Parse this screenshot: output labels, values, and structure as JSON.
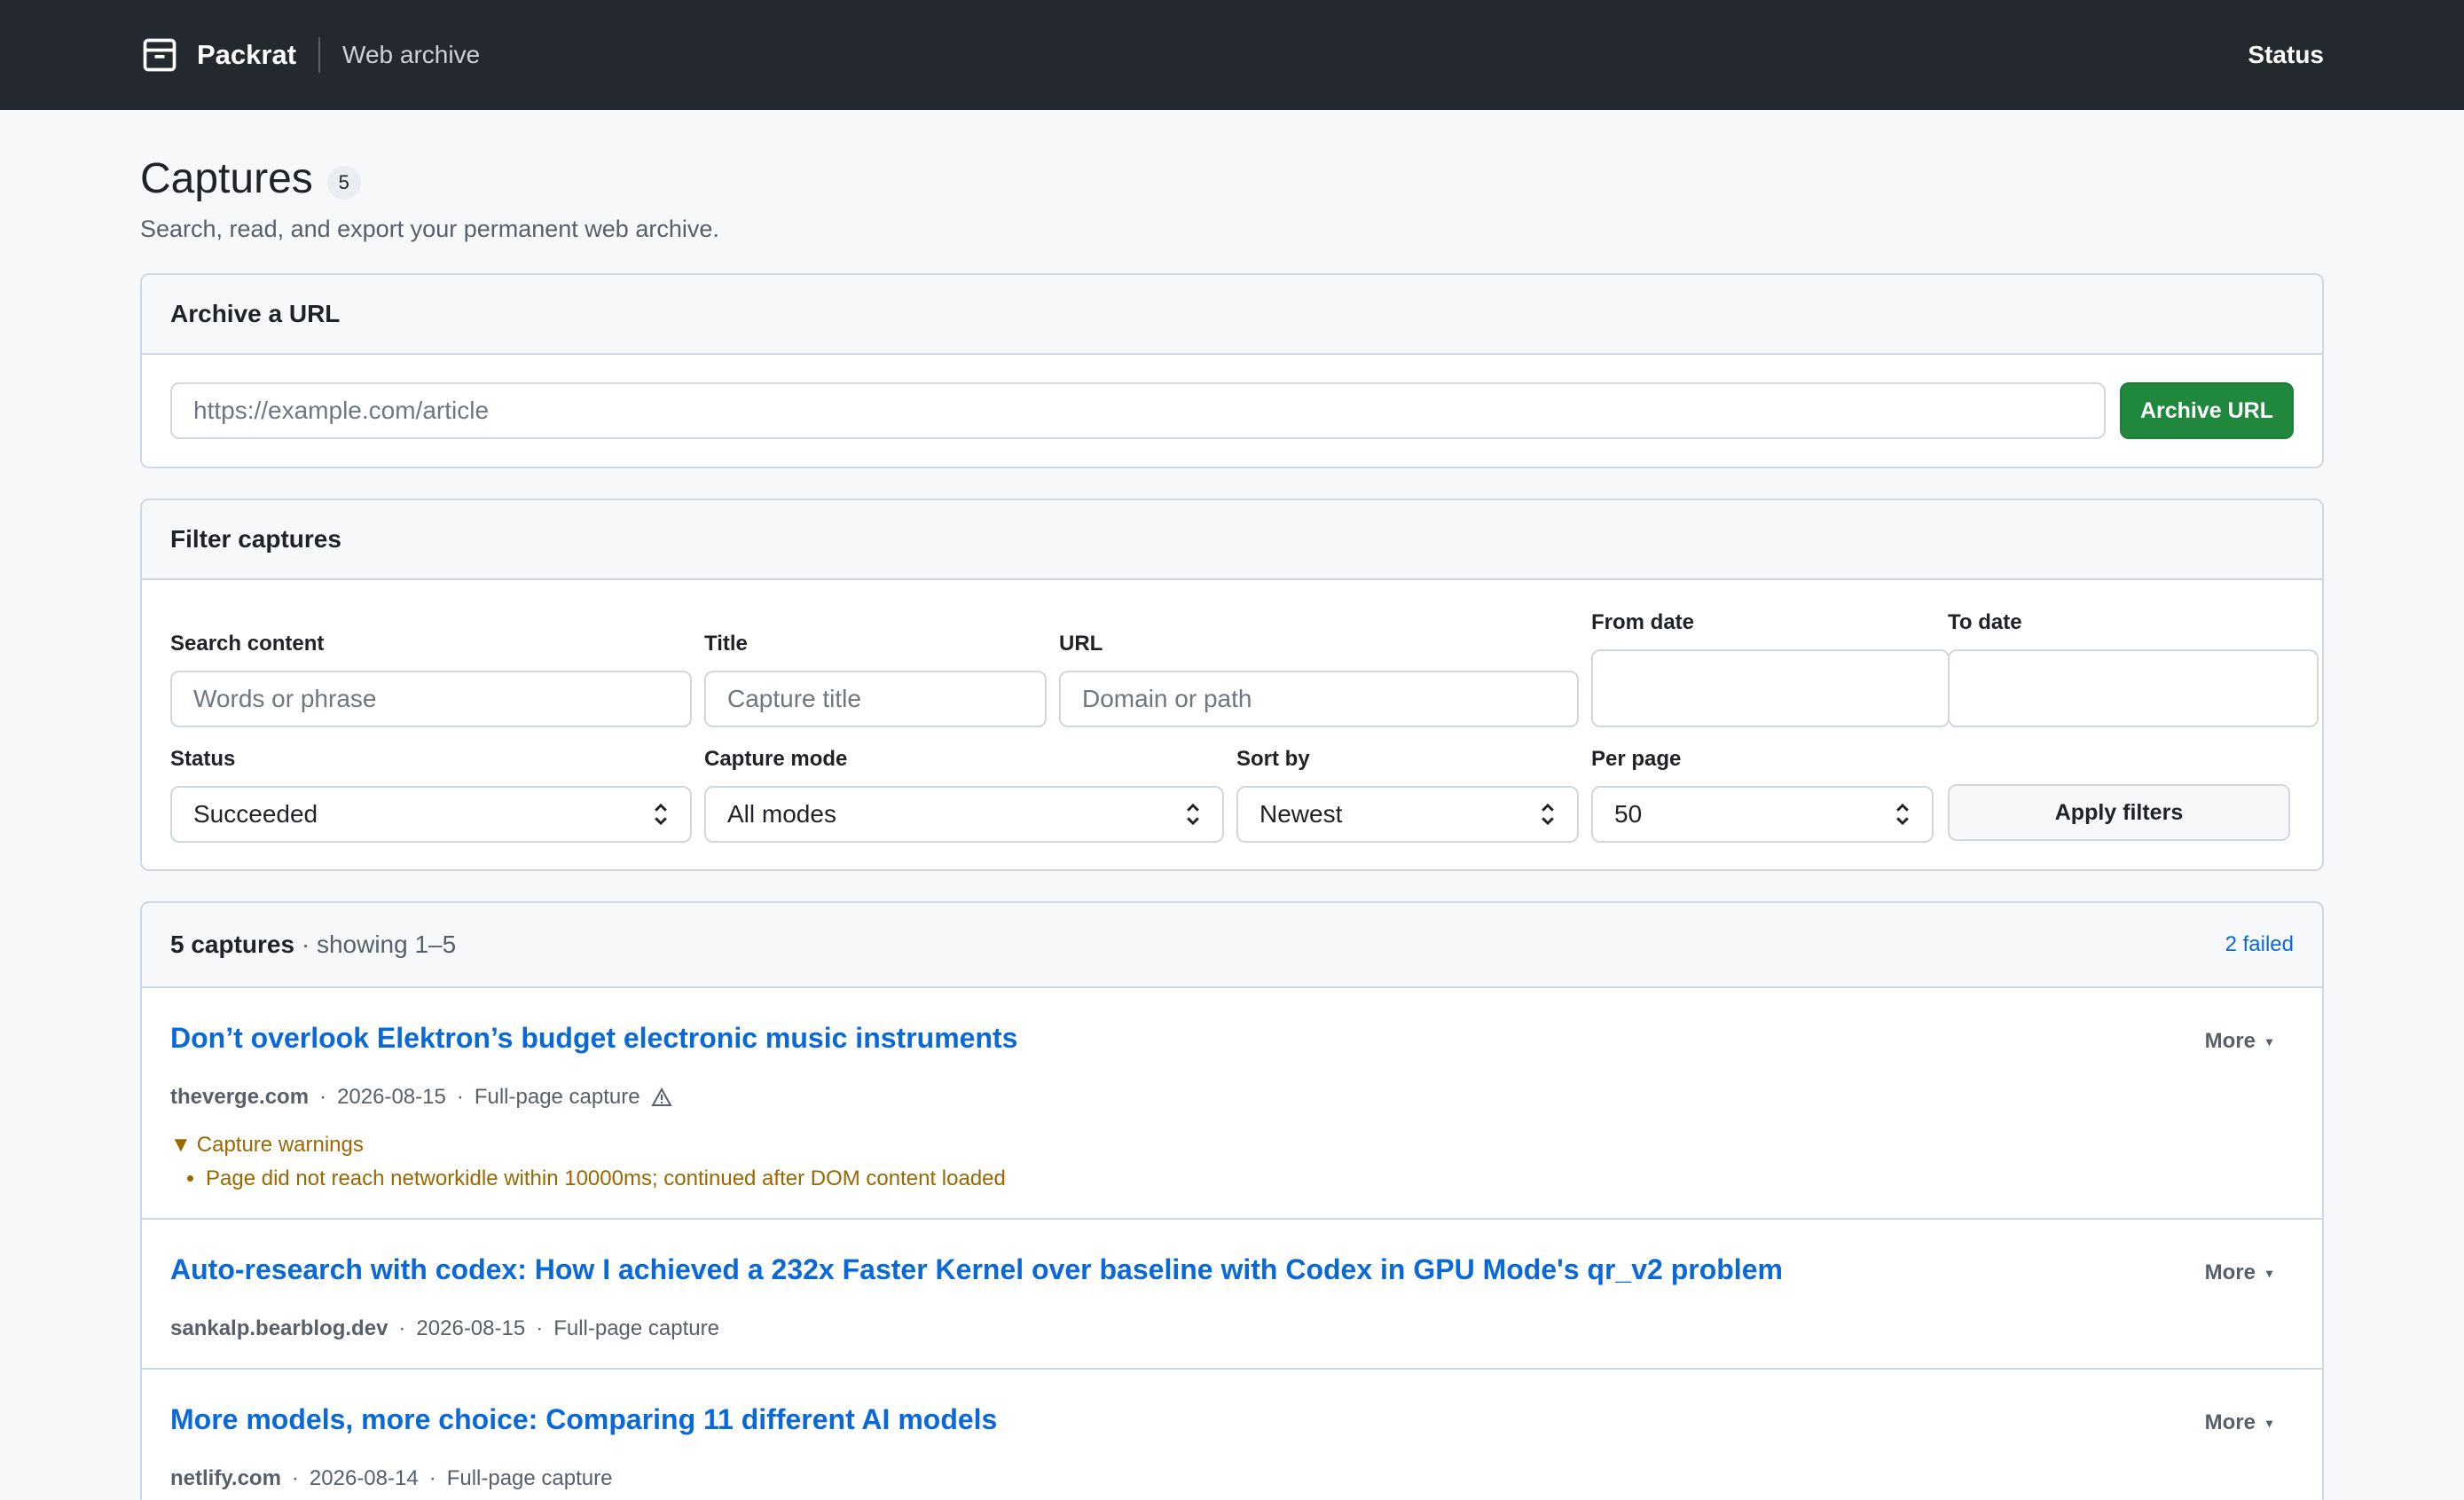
{
  "header": {
    "brand": "Packrat",
    "subtitle": "Web archive",
    "nav_status": "Status"
  },
  "page": {
    "title": "Captures",
    "count": "5",
    "subtitle": "Search, read, and export your permanent web archive."
  },
  "archive": {
    "heading": "Archive a URL",
    "url_placeholder": "https://example.com/article",
    "url_value": "",
    "button": "Archive URL"
  },
  "filters": {
    "heading": "Filter captures",
    "search_label": "Search content",
    "search_placeholder": "Words or phrase",
    "title_label": "Title",
    "title_placeholder": "Capture title",
    "url_label": "URL",
    "url_placeholder": "Domain or path",
    "from_label": "From date",
    "to_label": "To date",
    "status_label": "Status",
    "status_value": "Succeeded",
    "mode_label": "Capture mode",
    "mode_value": "All modes",
    "sort_label": "Sort by",
    "sort_value": "Newest",
    "perpage_label": "Per page",
    "perpage_value": "50",
    "apply_button": "Apply filters"
  },
  "results": {
    "count_label": "5 captures",
    "showing": "· showing 1–5",
    "failed_link": "2 failed",
    "more_label": "More",
    "items": [
      {
        "title": "Don’t overlook Elektron’s budget electronic music instruments",
        "domain": "theverge.com",
        "date": "2026-08-15",
        "mode": "Full-page capture",
        "warnings_summary": "Capture warnings",
        "warnings": [
          "Page did not reach networkidle within 10000ms; continued after DOM content loaded"
        ]
      },
      {
        "title": "Auto-research with codex: How I achieved a 232x Faster Kernel over baseline with Codex in GPU Mode's qr_v2 problem",
        "domain": "sankalp.bearblog.dev",
        "date": "2026-08-15",
        "mode": "Full-page capture"
      },
      {
        "title": "More models, more choice: Comparing 11 different AI models",
        "domain": "netlify.com",
        "date": "2026-08-14",
        "mode": "Full-page capture"
      }
    ]
  },
  "colors": {
    "header_bg": "#24292f",
    "link": "#0969da",
    "primary_button": "#1f883d",
    "warning": "#9a6700"
  },
  "icons": {
    "brand": "archive-box-icon",
    "warning": "warning-triangle-icon",
    "select": "chevron-up-down-icon",
    "more": "caret-down-icon"
  }
}
